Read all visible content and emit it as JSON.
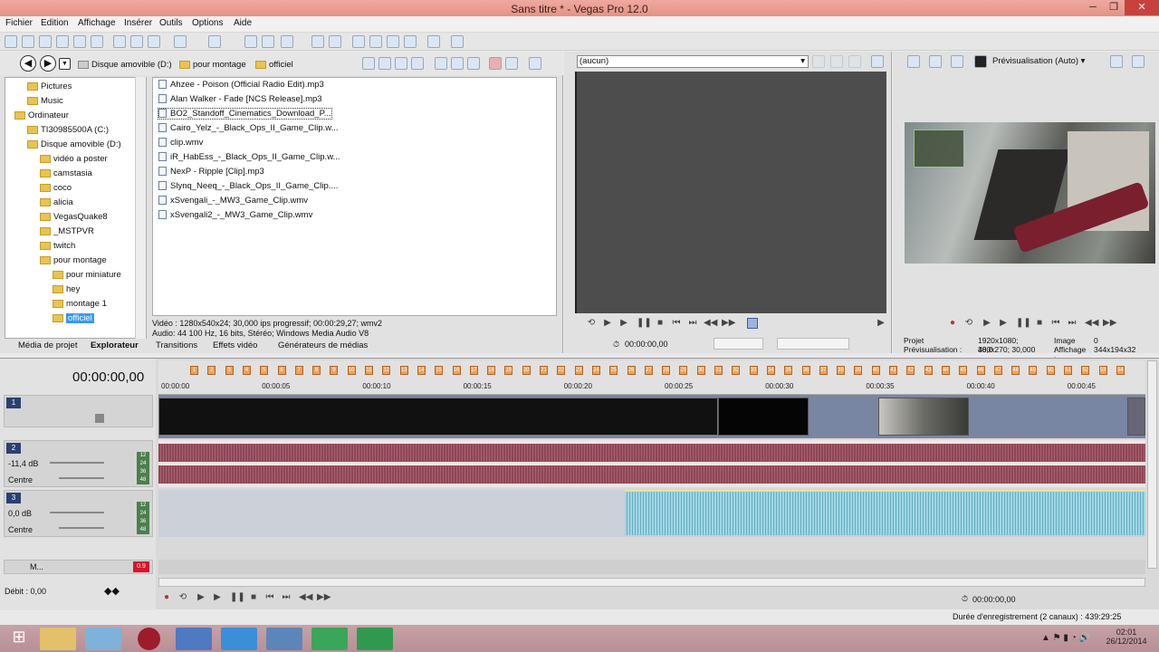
{
  "window": {
    "title": "Sans titre * - Vegas Pro 12.0"
  },
  "menu": [
    "Fichier",
    "Edition",
    "Affichage",
    "Insérer",
    "Outils",
    "Options",
    "Aide"
  ],
  "explorer": {
    "breadcrumb": [
      "Disque amovible (D:)",
      "pour montage",
      "officiel"
    ],
    "tree": [
      {
        "label": "Pictures",
        "indent": 2
      },
      {
        "label": "Music",
        "indent": 2
      },
      {
        "label": "Ordinateur",
        "indent": 1
      },
      {
        "label": "TI30985500A (C:)",
        "indent": 2
      },
      {
        "label": "Disque amovible (D:)",
        "indent": 2
      },
      {
        "label": "vidéo a poster",
        "indent": 3
      },
      {
        "label": "camstasia",
        "indent": 3
      },
      {
        "label": "coco",
        "indent": 3
      },
      {
        "label": "alicia",
        "indent": 3
      },
      {
        "label": "VegasQuake8",
        "indent": 3
      },
      {
        "label": "_MSTPVR",
        "indent": 3
      },
      {
        "label": "twitch",
        "indent": 3
      },
      {
        "label": "pour montage",
        "indent": 3
      },
      {
        "label": "pour miniature",
        "indent": 4
      },
      {
        "label": "hey",
        "indent": 4
      },
      {
        "label": "montage 1",
        "indent": 4
      },
      {
        "label": "officiel",
        "indent": 4
      }
    ],
    "files": [
      "Ahzee - Poison (Official Radio Edit).mp3",
      "Alan Walker - Fade [NCS Release].mp3",
      "BO2_Standoff_Cinematics_Download_P...",
      "Cairo_Yelz_-_Black_Ops_II_Game_Clip.w...",
      "clip.wmv",
      "iR_HabEss_-_Black_Ops_II_Game_Clip.w...",
      "NexP - Ripple [Clip].mp3",
      "Slynq_Neeq_-_Black_Ops_II_Game_Clip....",
      "xSvengali_-_MW3_Game_Clip.wmv",
      "xSvengali2_-_MW3_Game_Clip.wmv"
    ],
    "info_line1": "Vidéo : 1280x540x24; 30,000 ips progressif; 00:00:29,27; wmv2",
    "info_line2": "Audio: 44 100 Hz, 16 bits, Stéréo; Windows Media Audio V8",
    "tabs": [
      "Média de projet",
      "Explorateur",
      "Transitions",
      "Effets vidéo",
      "Générateurs de médias"
    ]
  },
  "trimmer": {
    "select": "(aucun)",
    "timecode": "00:00:00,00"
  },
  "preview": {
    "mode": "Prévisualisation (Auto)",
    "projet_label": "Projet :",
    "projet_val": "1920x1080; 30,0",
    "prev_label": "Prévisualisation :",
    "prev_val": "480x270; 30,000",
    "image_label": "Image :",
    "image_val": "0",
    "aff_label": "Affichage :",
    "aff_val": "344x194x32"
  },
  "timeline": {
    "timecode": "00:00:00,00",
    "ruler": [
      "00:00:00",
      "00:00:05",
      "00:00:10",
      "00:00:15",
      "00:00:20",
      "00:00:25",
      "00:00:30",
      "00:00:35",
      "00:00:40",
      "00:00:45"
    ],
    "markers": [
      "1",
      "2",
      "3",
      "4",
      "5",
      "6",
      "7",
      "8",
      "9",
      "10",
      "11",
      "12",
      "13",
      "14",
      "15",
      "16",
      "17",
      "18",
      "19",
      "20",
      "21",
      "22",
      "23",
      "24",
      "25",
      "26",
      "27",
      "28",
      "29",
      "30",
      "31",
      "32",
      "33",
      "34",
      "35",
      "36",
      "37",
      "38",
      "39",
      "40",
      "41",
      "42",
      "43",
      "44",
      "45",
      "46",
      "47",
      "48",
      "49",
      "50",
      "51",
      "52",
      "53",
      "54"
    ],
    "track1": {
      "num": "1"
    },
    "track2": {
      "num": "2",
      "vol": "-11,4 dB",
      "pan": "Centre"
    },
    "track3": {
      "num": "3",
      "vol": "0,0 dB",
      "pan": "Centre"
    },
    "master": {
      "label": "M...",
      "peak": "0.9"
    },
    "meters": [
      "12",
      "24",
      "36",
      "48"
    ],
    "rate": "Débit : 0,00",
    "bottom_timecode": "00:00:00,00",
    "rec": "Durée d'enregistrement (2 canaux) : 439:29:25"
  },
  "clock": {
    "time": "02:01",
    "date": "26/12/2014"
  }
}
